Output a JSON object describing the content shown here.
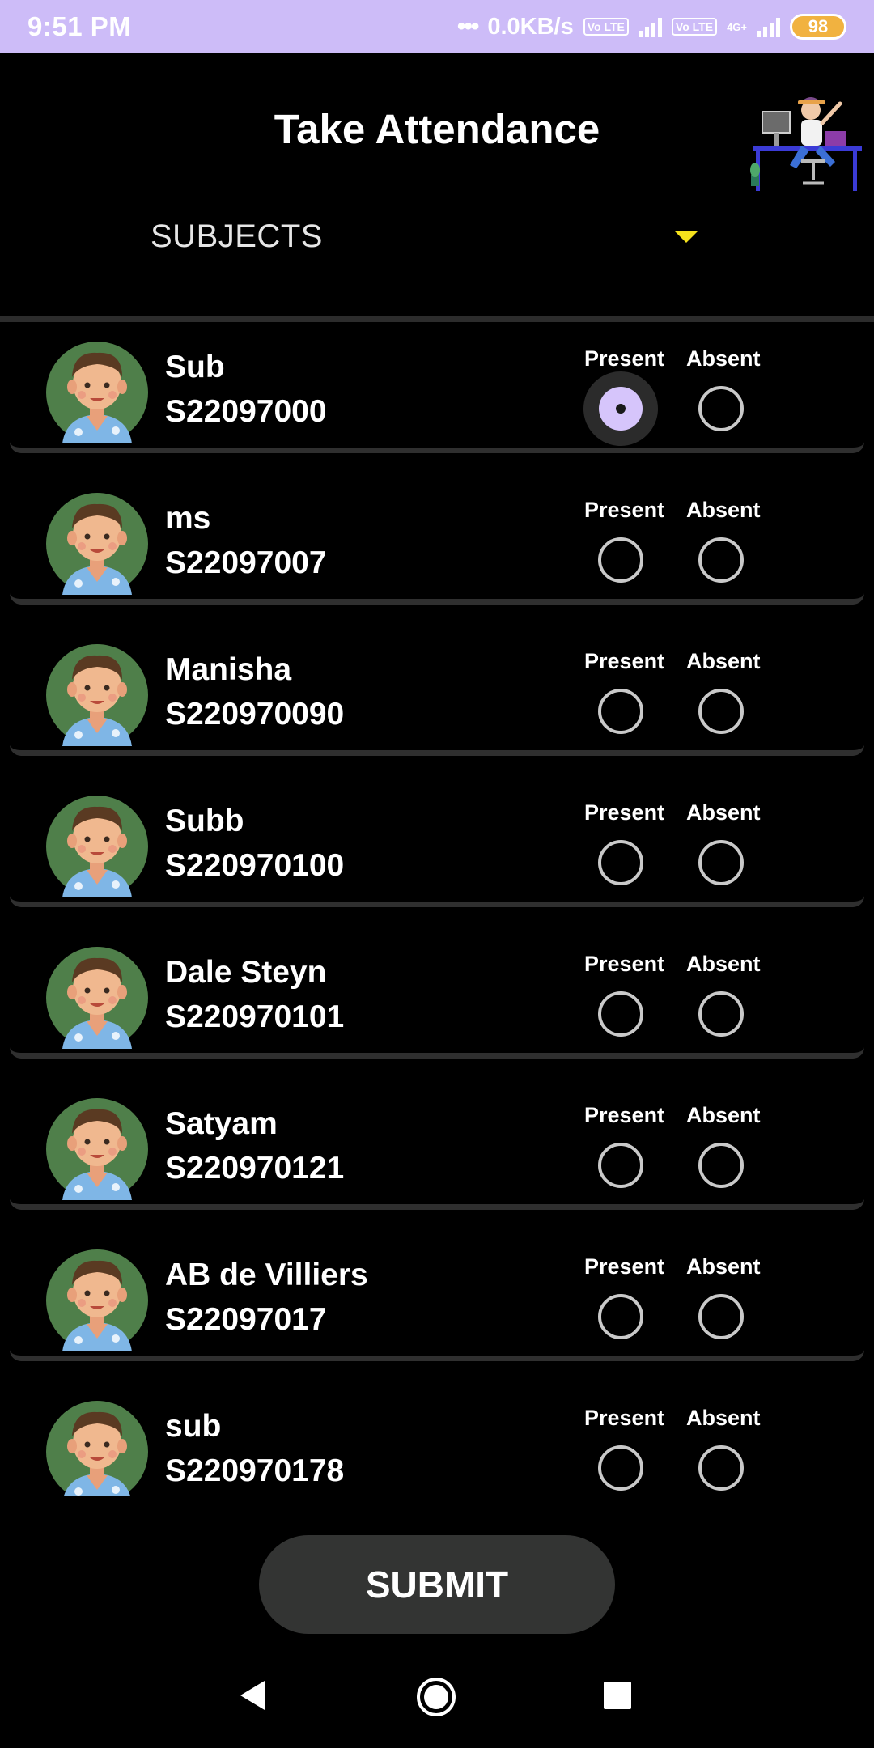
{
  "status_bar": {
    "time": "9:51 PM",
    "dots": "•••",
    "network_speed": "0.0KB/s",
    "volte_label": "Vo LTE",
    "net_type": "4G+",
    "battery": "98"
  },
  "header": {
    "title": "Take Attendance",
    "illustration_icon": "person-at-computer-illustration"
  },
  "subjects_dropdown": {
    "selected": "SUBJECTS",
    "caret_color": "#f5e21c"
  },
  "options": {
    "present_label": "Present",
    "absent_label": "Absent"
  },
  "students": [
    {
      "name": "Sub",
      "id": "S22097000",
      "selected": "present"
    },
    {
      "name": "ms",
      "id": "S22097007",
      "selected": null
    },
    {
      "name": "Manisha",
      "id": "S220970090",
      "selected": null
    },
    {
      "name": "Subb",
      "id": "S220970100",
      "selected": null
    },
    {
      "name": "Dale Steyn",
      "id": "S220970101",
      "selected": null
    },
    {
      "name": "Satyam",
      "id": "S220970121",
      "selected": null
    },
    {
      "name": "AB de Villiers",
      "id": "S22097017",
      "selected": null
    },
    {
      "name": "sub",
      "id": "S220970178",
      "selected": null
    }
  ],
  "submit_label": "SUBMIT",
  "colors": {
    "status_bar": "#cdbcf8",
    "radio_selected": "#d6c5fb",
    "card_border": "#2f2f2f",
    "submit_bg": "#333433"
  },
  "nav_icons": [
    "back-icon",
    "home-icon",
    "recents-icon"
  ]
}
